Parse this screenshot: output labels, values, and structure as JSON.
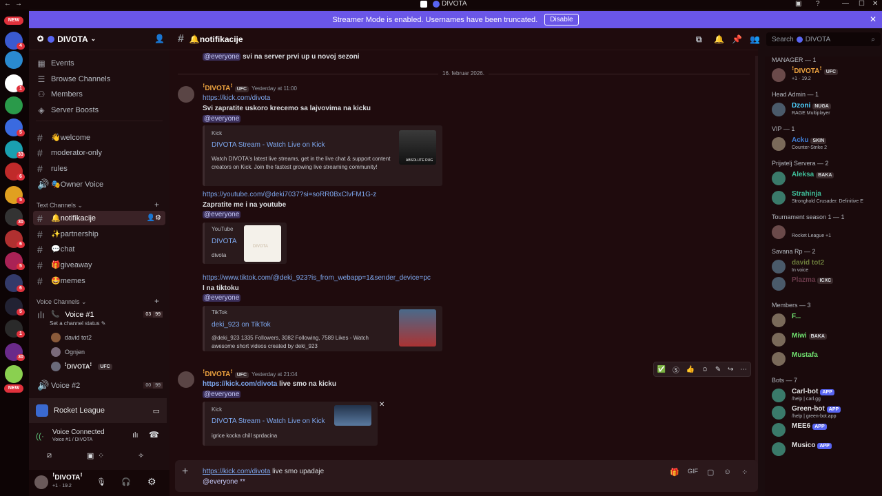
{
  "window": {
    "title": "DIVOTA"
  },
  "banner": {
    "text": "Streamer Mode is enabled. Usernames have been truncated.",
    "button": "Disable"
  },
  "guilds": {
    "new_badge": "NEW",
    "badges": [
      "4",
      "",
      "1",
      "",
      "5",
      "33",
      "6",
      "5",
      "30",
      "6",
      "5",
      "6",
      "5",
      "1",
      "30"
    ]
  },
  "server": {
    "name": "DIVOTA"
  },
  "sidebar": {
    "nav": [
      {
        "icon": "calendar-icon",
        "label": "Events"
      },
      {
        "icon": "list-icon",
        "label": "Browse Channels"
      },
      {
        "icon": "members-icon",
        "label": "Members"
      },
      {
        "icon": "boost-icon",
        "label": "Server Boosts"
      }
    ],
    "channels_top": [
      "👋welcome",
      "moderator-only",
      "rules",
      "🎭Owner Voice"
    ],
    "text_category": "Text Channels",
    "text_channels": [
      "🔔notifikacije",
      "✨partnership",
      "💬chat",
      "🎁giveaway",
      "🤩memes"
    ],
    "voice_category": "Voice Channels",
    "voice1": {
      "name": "Voice #1",
      "status": "Set a channel status",
      "count_a": "03",
      "count_b": "99"
    },
    "voice_users": [
      "david tot2",
      "Ognjen",
      "ꜝDIVOTAꜝ"
    ],
    "voice_user_tag": "UFC",
    "voice2": {
      "name": "Voice #2",
      "count_a": "00",
      "count_b": "99"
    },
    "activity": "Rocket League",
    "voice_connected": {
      "title": "Voice Connected",
      "sub": "Voice #1 / ",
      "server": "DIVOTA"
    },
    "user": {
      "name": "ꜝDIVOTAꜝ",
      "status": "+1 · 19.2"
    }
  },
  "header": {
    "channel": "🔔notifikacije",
    "search": "Search",
    "search_server": "DIVOTA"
  },
  "messages": {
    "prev_line": "svi na server prvi up u novoj sezoni",
    "everyone": "@everyone",
    "date_divider": "16. februar 2026.",
    "m1": {
      "author": "ꜝDIVOTAꜝ",
      "tag": "UFC",
      "time": "Yesterday at 11:00",
      "link": "https://kick.com/divota",
      "text": "Svi zapratite uskoro krecemo sa lajvovima na kicku",
      "embed": {
        "provider": "Kick",
        "title": "DIVOTA Stream - Watch Live on Kick",
        "desc": "Watch DIVOTA's latest live streams, get in the live chat & support content creators on Kick. Join the fastest growing live streaming community!",
        "thumb_text": "ABSOLUTE RUG"
      },
      "yt_link": "https://youtube.com/@deki7037?si=soRR0BxClvFM1G-z",
      "yt_text": "Zapratite me i na youtube",
      "yt_embed": {
        "provider": "YouTube",
        "title": "DIVOTA",
        "desc": "divota",
        "thumb_text": "DIVOTA"
      },
      "tt_link": "https://www.tiktok.com/@deki_923?is_from_webapp=1&sender_device=pc",
      "tt_text": "I na tiktoku",
      "tt_embed": {
        "provider": "TikTok",
        "title": "deki_923 on TikTok",
        "desc": "@deki_923 1335 Followers, 3082 Following, 7589 Likes - Watch awesome short videos created by deki_923"
      }
    },
    "m2": {
      "author": "ꜝDIVOTAꜝ",
      "tag": "UFC",
      "time": "Yesterday at 21:04",
      "link": "https://kick.com/divota",
      "text": " live smo na kicku",
      "embed": {
        "provider": "Kick",
        "title": "DIVOTA Stream - Watch Live on Kick",
        "desc": "igrice kocka chill sprdacina"
      }
    }
  },
  "composer": {
    "link": "https://kick.com/divota",
    "text": " live smo upadaje",
    "line2": "@everyone **"
  },
  "members": {
    "groups": [
      {
        "title": "MANAGER — 1",
        "users": [
          {
            "name": "ꜝDIVOTAꜝ",
            "tag": "UFC",
            "sub": "+1 · 19.2",
            "color": "#f0a540"
          }
        ]
      },
      {
        "title": "Head Admin — 1",
        "users": [
          {
            "name": "Dzoni",
            "tag": "NUGA",
            "sub": "RAGE Multiplayer",
            "color": "#4dd2ff"
          }
        ]
      },
      {
        "title": "VIP — 1",
        "users": [
          {
            "name": "Acku",
            "tag": "SKIN",
            "sub": "Counter-Strike 2",
            "color": "#3f7fd8"
          }
        ]
      },
      {
        "title": "Prijatelj Servera — 2",
        "users": [
          {
            "name": "Aleksa",
            "tag": "BAKA",
            "sub": "",
            "color": "#3fbf9a"
          },
          {
            "name": "Strahinja",
            "tag": "",
            "sub": "Stronghold Crusader: Definitive E",
            "color": "#3fbf9a"
          }
        ]
      },
      {
        "title": "Tournament season 1 — 1",
        "users": [
          {
            "name": "",
            "tag": "",
            "sub": "Rocket League +1",
            "color": "#d04040"
          }
        ]
      },
      {
        "title": "Savana Rp — 2",
        "users": [
          {
            "name": "david tot2",
            "tag": "",
            "sub": "In voice",
            "color": "#6a7a3a"
          },
          {
            "name": "Plazma",
            "tag": "ICXC",
            "sub": "",
            "color": "#6b3a4a"
          }
        ]
      },
      {
        "title": "Members — 3",
        "users": [
          {
            "name": "F...",
            "tag": "",
            "sub": "",
            "color": "#6fe06f"
          },
          {
            "name": "Miwi",
            "tag": "BAKA",
            "sub": "",
            "color": "#6fe06f"
          },
          {
            "name": "Mustafa",
            "tag": "",
            "sub": "",
            "color": "#6fe06f"
          }
        ]
      },
      {
        "title": "Bots — 7",
        "users": [
          {
            "name": "Carl-bot",
            "tag": "APP",
            "sub": "/help | carl.gg",
            "color": "#e0e0e0"
          },
          {
            "name": "Green-bot",
            "tag": "APP",
            "sub": "/help | green-bot.app",
            "color": "#e0e0e0"
          },
          {
            "name": "MEE6",
            "tag": "APP",
            "sub": "",
            "color": "#e0e0e0"
          },
          {
            "name": "Musico",
            "tag": "APP",
            "sub": "",
            "color": "#e0e0e0"
          }
        ]
      }
    ]
  }
}
